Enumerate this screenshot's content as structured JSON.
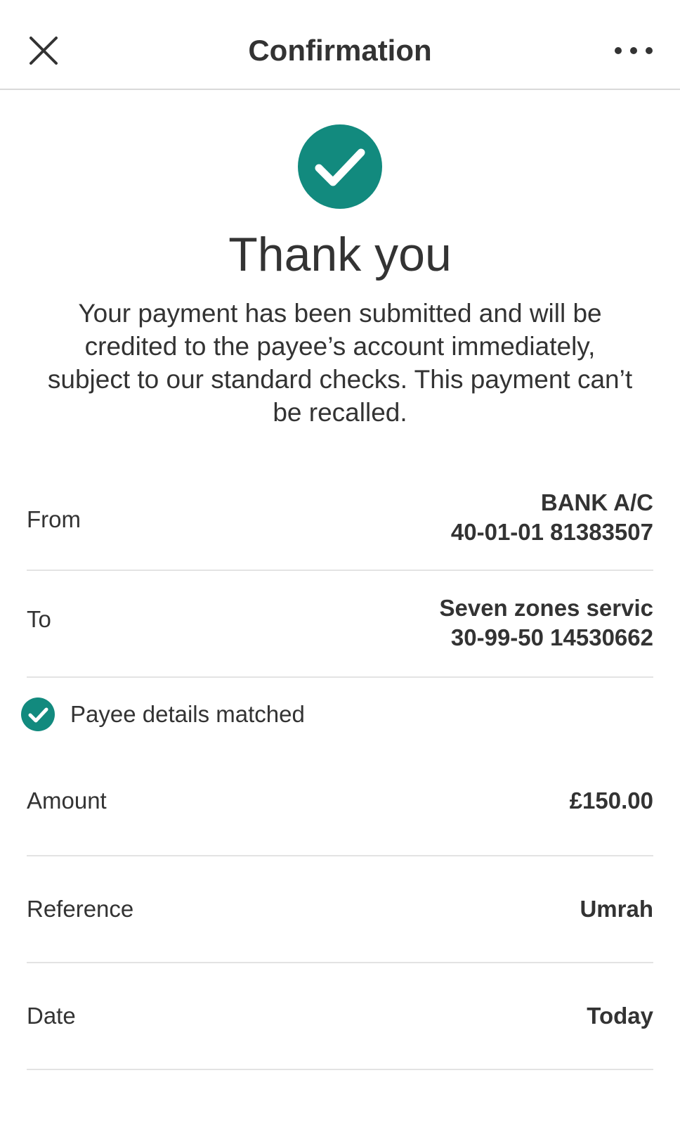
{
  "header": {
    "title": "Confirmation"
  },
  "status": {
    "heading": "Thank you",
    "message": "Your payment has been submitted and will be credited to the payee’s account immediately, subject to our standard checks. This payment can’t be recalled."
  },
  "details": {
    "from": {
      "label": "From",
      "account_name": "BANK A/C",
      "account_number": "40-01-01 81383507"
    },
    "to": {
      "label": "To",
      "payee_name": "Seven zones servic",
      "account_number": "30-99-50 14530662"
    },
    "payee_check": "Payee details matched",
    "amount": {
      "label": "Amount",
      "value": "£150.00"
    },
    "reference": {
      "label": "Reference",
      "value": "Umrah"
    },
    "date": {
      "label": "Date",
      "value": "Today"
    }
  },
  "colors": {
    "accent": "#128A7E",
    "text": "#333333",
    "divider": "#E3E3E3"
  },
  "icons": {
    "close": "close-icon",
    "more": "more-options-icon",
    "success": "checkmark-circle-icon",
    "matched": "checkmark-circle-icon"
  }
}
